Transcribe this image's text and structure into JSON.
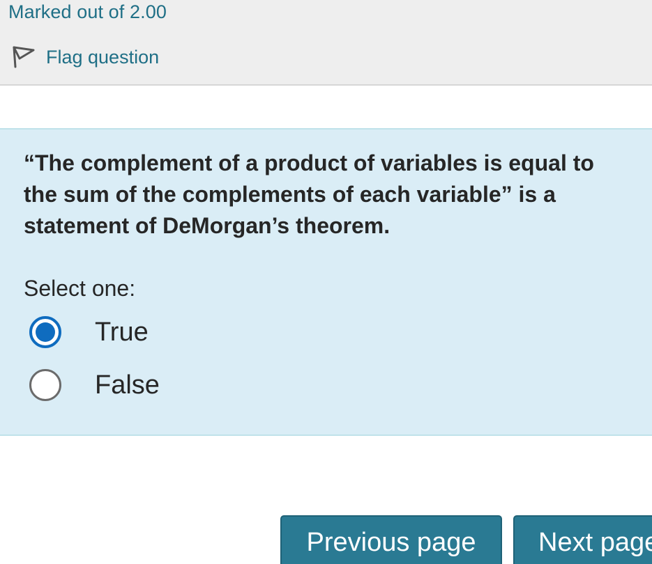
{
  "info": {
    "marked_out_of": "Marked out of 2.00",
    "flag_label": "Flag question"
  },
  "question": {
    "text": "“The complement of a product of variables is equal to the sum of the complements of each variable” is a statement of DeMorgan’s theorem.",
    "prompt": "Select one:",
    "options": [
      {
        "label": "True",
        "selected": true
      },
      {
        "label": "False",
        "selected": false
      }
    ]
  },
  "navigation": {
    "previous_label": "Previous page",
    "next_label": "Next page"
  },
  "colors": {
    "link": "#1f6f86",
    "content_bg": "#daedf6",
    "button_bg": "#2a7a93",
    "radio_selected": "#0f6cbf"
  },
  "icons": {
    "flag": "flag-icon"
  }
}
